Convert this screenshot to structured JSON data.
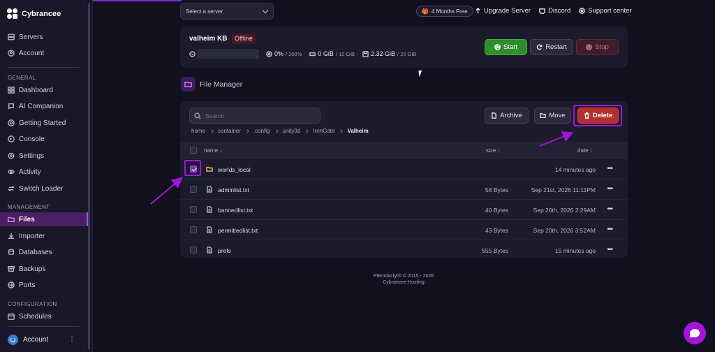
{
  "brand": {
    "name": "Cybrancee"
  },
  "sidebar": {
    "top_items": [
      {
        "label": "Servers",
        "icon": "servers-icon"
      },
      {
        "label": "Account",
        "icon": "account-icon"
      }
    ],
    "sections": {
      "general": "GENERAL",
      "management": "MANAGEMENT",
      "configuration": "CONFIGURATION"
    },
    "general_items": [
      {
        "label": "Dashboard",
        "icon": "dashboard-icon"
      },
      {
        "label": "AI Companion",
        "icon": "ai-icon"
      },
      {
        "label": "Getting Started",
        "icon": "help-icon"
      },
      {
        "label": "Console",
        "icon": "console-icon"
      },
      {
        "label": "Settings",
        "icon": "gear-icon"
      },
      {
        "label": "Activity",
        "icon": "eye-icon"
      },
      {
        "label": "Switch Loader",
        "icon": "switch-icon"
      }
    ],
    "management_items": [
      {
        "label": "Files",
        "icon": "folder-icon",
        "active": true
      },
      {
        "label": "Importer",
        "icon": "import-icon"
      },
      {
        "label": "Databases",
        "icon": "database-icon"
      },
      {
        "label": "Backups",
        "icon": "archive-icon"
      },
      {
        "label": "Ports",
        "icon": "globe-icon"
      }
    ],
    "configuration_items": [
      {
        "label": "Schedules",
        "icon": "calendar-icon"
      }
    ],
    "account_label": "Account"
  },
  "topbar": {
    "server_select_placeholder": "Select a server",
    "promo": "4 Months Free",
    "links": [
      "Upgrade Server",
      "Discord",
      "Support center"
    ]
  },
  "server": {
    "name": "valheim KB",
    "status": "Offline",
    "cpu": "0%",
    "cpu_max": "/ 200%",
    "memory": "0 GiB",
    "memory_max": "/ 10 GiB",
    "disk": "2.32 GiB",
    "disk_max": "/ 20 GiB",
    "buttons": {
      "start": "Start",
      "restart": "Restart",
      "stop": "Stop"
    }
  },
  "file_manager": {
    "title": "File Manager",
    "search_placeholder": "Search",
    "actions": {
      "archive": "Archive",
      "move": "Move",
      "delete": "Delete"
    },
    "breadcrumb": [
      "home",
      "container",
      ".config",
      "unity3d",
      "IronGate",
      "Valheim"
    ],
    "columns": {
      "name": "name",
      "size": "size",
      "date": "date"
    },
    "files": [
      {
        "name": "worlds_local",
        "type": "folder",
        "size": "",
        "date": "14 minutes ago",
        "checked": true
      },
      {
        "name": "adminlist.txt",
        "type": "file",
        "size": "58 Bytes",
        "date": "Sep 21st, 2026 11:11PM",
        "checked": false
      },
      {
        "name": "bannedlist.txt",
        "type": "file",
        "size": "40 Bytes",
        "date": "Sep 20th, 2026 2:29AM",
        "checked": false
      },
      {
        "name": "permittedlist.txt",
        "type": "file",
        "size": "43 Bytes",
        "date": "Sep 20th, 2026 3:52AM",
        "checked": false
      },
      {
        "name": "prefs",
        "type": "file",
        "size": "555 Bytes",
        "date": "15 minutes ago",
        "checked": false
      }
    ]
  },
  "footer": {
    "line1": "Pterodactyl® © 2015 - 2026",
    "line2": "Cybrancee Hosting"
  },
  "colors": {
    "accent": "#a014d8",
    "start": "#2e8d2c",
    "delete": "#b62e31",
    "offline_bg": "#4a1a25"
  }
}
